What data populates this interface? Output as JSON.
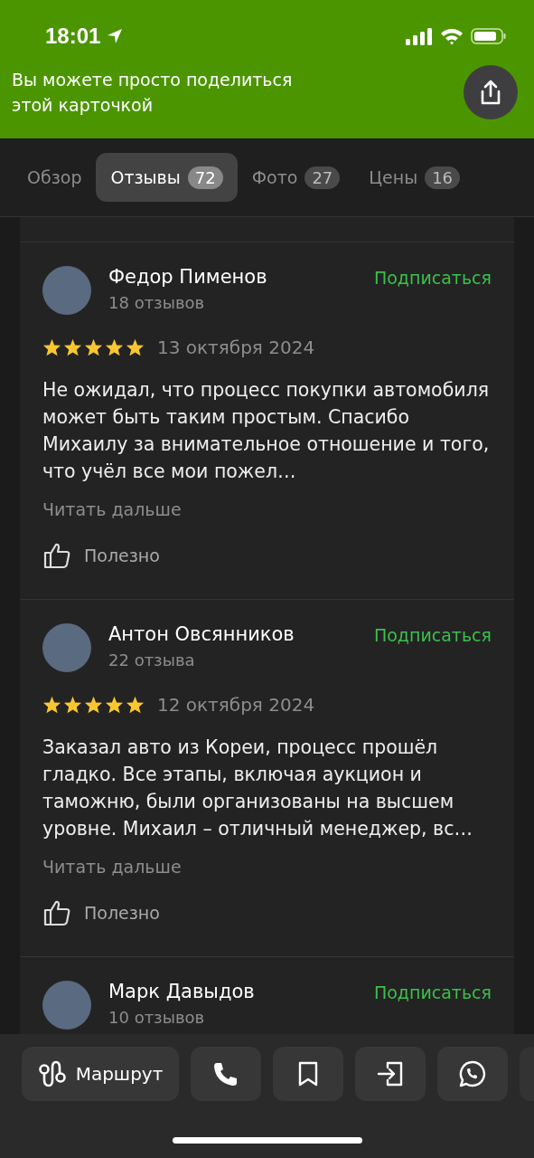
{
  "status_bar": {
    "time": "18:01"
  },
  "banner": {
    "text": "Вы можете просто поделиться этой карточкой"
  },
  "tabs": [
    {
      "label": "Обзор",
      "selected": false
    },
    {
      "label": "Отзывы",
      "count": "72",
      "selected": true
    },
    {
      "label": "Фото",
      "count": "27",
      "selected": false
    },
    {
      "label": "Цены",
      "count": "16",
      "selected": false
    }
  ],
  "reviews": [
    {
      "author": "Федор Пименов",
      "reviews_count": "18 отзывов",
      "subscribe": "Подписаться",
      "stars": 5,
      "date": "13 октября 2024",
      "text": "Не ожидал, что процесс покупки автомобиля может быть таким простым. Спасибо Михаилу за внимательное отношение и того, что учёл все мои пожел…",
      "read_more": "Читать дальше",
      "useful": "Полезно"
    },
    {
      "author": "Антон Овсянников",
      "reviews_count": "22 отзыва",
      "subscribe": "Подписаться",
      "stars": 5,
      "date": "12 октября 2024",
      "text": "Заказал авто из Кореи, процесс прошёл гладко. Все этапы, включая аукцион и таможню, были организованы на высшем уровне. Михаил – отличный менеджер, вс…",
      "read_more": "Читать дальше",
      "useful": "Полезно"
    },
    {
      "author": "Марк Давыдов",
      "reviews_count": "10 отзывов",
      "subscribe": "Подписаться"
    }
  ],
  "actions": [
    {
      "kind": "route",
      "label": "Маршрут"
    },
    {
      "kind": "phone"
    },
    {
      "kind": "bookmark"
    },
    {
      "kind": "enter"
    },
    {
      "kind": "chat"
    }
  ]
}
